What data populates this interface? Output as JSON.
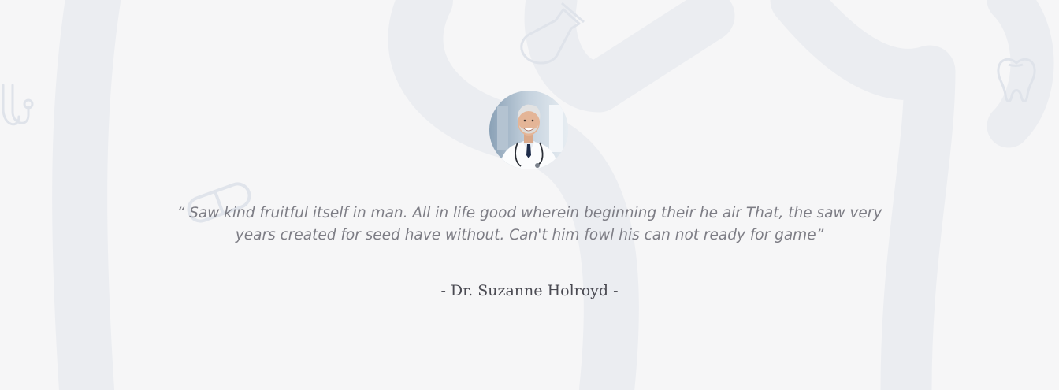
{
  "testimonial": {
    "avatar_icon": "doctor-portrait",
    "quote": "“ Saw kind fruitful itself in man. All in life good wherein beginning their he air That, the saw very years created for seed have without. Can't him fowl his can not ready for game”",
    "author": "- Dr. Suzanne Holroyd -"
  },
  "decorations": {
    "icons": [
      "stethoscope-icon",
      "pill-icon",
      "flask-icon",
      "tooth-icon"
    ],
    "accent_color": "#e8ebf0",
    "icon_color": "#d9dee7"
  }
}
